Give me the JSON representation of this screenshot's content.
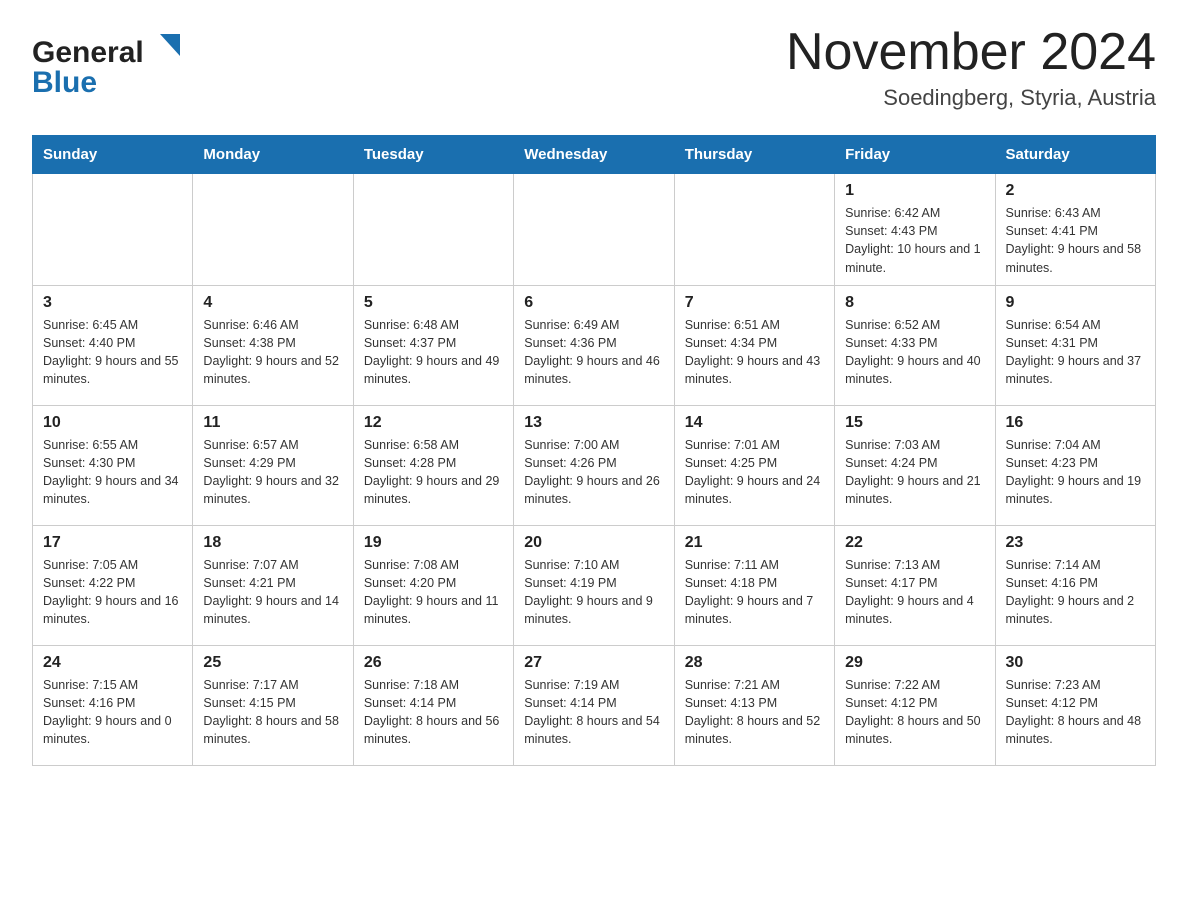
{
  "logo": {
    "general_text": "General",
    "blue_text": "Blue"
  },
  "title": "November 2024",
  "subtitle": "Soedingberg, Styria, Austria",
  "weekdays": [
    "Sunday",
    "Monday",
    "Tuesday",
    "Wednesday",
    "Thursday",
    "Friday",
    "Saturday"
  ],
  "weeks": [
    [
      {
        "day": "",
        "info": ""
      },
      {
        "day": "",
        "info": ""
      },
      {
        "day": "",
        "info": ""
      },
      {
        "day": "",
        "info": ""
      },
      {
        "day": "",
        "info": ""
      },
      {
        "day": "1",
        "info": "Sunrise: 6:42 AM\nSunset: 4:43 PM\nDaylight: 10 hours and 1 minute."
      },
      {
        "day": "2",
        "info": "Sunrise: 6:43 AM\nSunset: 4:41 PM\nDaylight: 9 hours and 58 minutes."
      }
    ],
    [
      {
        "day": "3",
        "info": "Sunrise: 6:45 AM\nSunset: 4:40 PM\nDaylight: 9 hours and 55 minutes."
      },
      {
        "day": "4",
        "info": "Sunrise: 6:46 AM\nSunset: 4:38 PM\nDaylight: 9 hours and 52 minutes."
      },
      {
        "day": "5",
        "info": "Sunrise: 6:48 AM\nSunset: 4:37 PM\nDaylight: 9 hours and 49 minutes."
      },
      {
        "day": "6",
        "info": "Sunrise: 6:49 AM\nSunset: 4:36 PM\nDaylight: 9 hours and 46 minutes."
      },
      {
        "day": "7",
        "info": "Sunrise: 6:51 AM\nSunset: 4:34 PM\nDaylight: 9 hours and 43 minutes."
      },
      {
        "day": "8",
        "info": "Sunrise: 6:52 AM\nSunset: 4:33 PM\nDaylight: 9 hours and 40 minutes."
      },
      {
        "day": "9",
        "info": "Sunrise: 6:54 AM\nSunset: 4:31 PM\nDaylight: 9 hours and 37 minutes."
      }
    ],
    [
      {
        "day": "10",
        "info": "Sunrise: 6:55 AM\nSunset: 4:30 PM\nDaylight: 9 hours and 34 minutes."
      },
      {
        "day": "11",
        "info": "Sunrise: 6:57 AM\nSunset: 4:29 PM\nDaylight: 9 hours and 32 minutes."
      },
      {
        "day": "12",
        "info": "Sunrise: 6:58 AM\nSunset: 4:28 PM\nDaylight: 9 hours and 29 minutes."
      },
      {
        "day": "13",
        "info": "Sunrise: 7:00 AM\nSunset: 4:26 PM\nDaylight: 9 hours and 26 minutes."
      },
      {
        "day": "14",
        "info": "Sunrise: 7:01 AM\nSunset: 4:25 PM\nDaylight: 9 hours and 24 minutes."
      },
      {
        "day": "15",
        "info": "Sunrise: 7:03 AM\nSunset: 4:24 PM\nDaylight: 9 hours and 21 minutes."
      },
      {
        "day": "16",
        "info": "Sunrise: 7:04 AM\nSunset: 4:23 PM\nDaylight: 9 hours and 19 minutes."
      }
    ],
    [
      {
        "day": "17",
        "info": "Sunrise: 7:05 AM\nSunset: 4:22 PM\nDaylight: 9 hours and 16 minutes."
      },
      {
        "day": "18",
        "info": "Sunrise: 7:07 AM\nSunset: 4:21 PM\nDaylight: 9 hours and 14 minutes."
      },
      {
        "day": "19",
        "info": "Sunrise: 7:08 AM\nSunset: 4:20 PM\nDaylight: 9 hours and 11 minutes."
      },
      {
        "day": "20",
        "info": "Sunrise: 7:10 AM\nSunset: 4:19 PM\nDaylight: 9 hours and 9 minutes."
      },
      {
        "day": "21",
        "info": "Sunrise: 7:11 AM\nSunset: 4:18 PM\nDaylight: 9 hours and 7 minutes."
      },
      {
        "day": "22",
        "info": "Sunrise: 7:13 AM\nSunset: 4:17 PM\nDaylight: 9 hours and 4 minutes."
      },
      {
        "day": "23",
        "info": "Sunrise: 7:14 AM\nSunset: 4:16 PM\nDaylight: 9 hours and 2 minutes."
      }
    ],
    [
      {
        "day": "24",
        "info": "Sunrise: 7:15 AM\nSunset: 4:16 PM\nDaylight: 9 hours and 0 minutes."
      },
      {
        "day": "25",
        "info": "Sunrise: 7:17 AM\nSunset: 4:15 PM\nDaylight: 8 hours and 58 minutes."
      },
      {
        "day": "26",
        "info": "Sunrise: 7:18 AM\nSunset: 4:14 PM\nDaylight: 8 hours and 56 minutes."
      },
      {
        "day": "27",
        "info": "Sunrise: 7:19 AM\nSunset: 4:14 PM\nDaylight: 8 hours and 54 minutes."
      },
      {
        "day": "28",
        "info": "Sunrise: 7:21 AM\nSunset: 4:13 PM\nDaylight: 8 hours and 52 minutes."
      },
      {
        "day": "29",
        "info": "Sunrise: 7:22 AM\nSunset: 4:12 PM\nDaylight: 8 hours and 50 minutes."
      },
      {
        "day": "30",
        "info": "Sunrise: 7:23 AM\nSunset: 4:12 PM\nDaylight: 8 hours and 48 minutes."
      }
    ]
  ]
}
